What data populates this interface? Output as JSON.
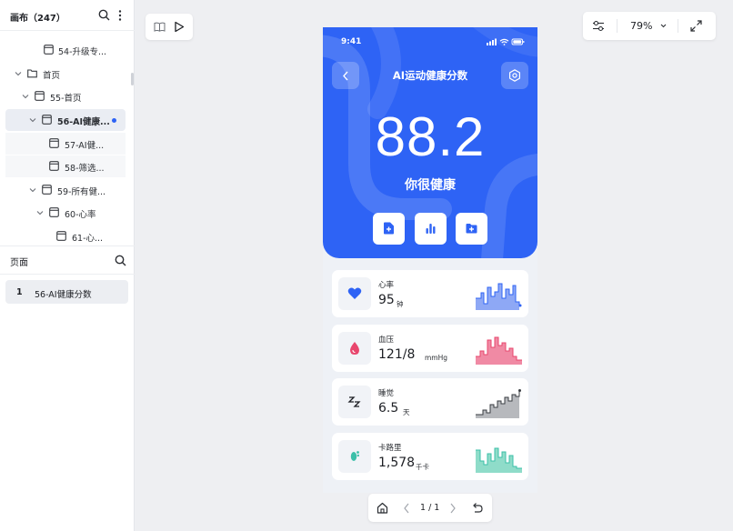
{
  "layers_panel": {
    "title": "画布（247）",
    "tree": [
      {
        "label": "54-升级专...",
        "kind": "frame"
      },
      {
        "label": "首页",
        "kind": "folder"
      },
      {
        "label": "55-首页",
        "kind": "frame"
      },
      {
        "label": "56-AI健康...",
        "kind": "frame",
        "selected": true
      },
      {
        "label": "57-AI健...",
        "kind": "frame"
      },
      {
        "label": "58-筛选...",
        "kind": "frame"
      },
      {
        "label": "59-所有健...",
        "kind": "frame"
      },
      {
        "label": "60-心率",
        "kind": "frame"
      },
      {
        "label": "61-心...",
        "kind": "frame"
      }
    ]
  },
  "pages_panel": {
    "title": "页面",
    "items": [
      {
        "num": "1",
        "label": "56-AI健康分数"
      }
    ]
  },
  "toolbar": {
    "zoom": "79%"
  },
  "pager": {
    "text": "1 / 1"
  },
  "phone": {
    "status_time": "9:41",
    "nav_title": "AI运动健康分数",
    "score": "88.2",
    "score_label": "你很健康",
    "accent": "#2e63f5",
    "metrics": [
      {
        "title": "心率",
        "value": "95",
        "unit": "钟",
        "icon": "heart-icon",
        "color": "#2e63f5"
      },
      {
        "title": "血压",
        "value": "121/8",
        "unit": "mmHg",
        "icon": "blood-drop-icon",
        "color": "#e8466d"
      },
      {
        "title": "睡觉",
        "value": "6.5",
        "unit": "天",
        "icon": "sleep-zzz-icon",
        "color": "#1d1f24"
      },
      {
        "title": "卡路里",
        "value": "1,578",
        "unit": "千卡",
        "icon": "footprint-icon",
        "color": "#3bbfa8"
      }
    ]
  }
}
